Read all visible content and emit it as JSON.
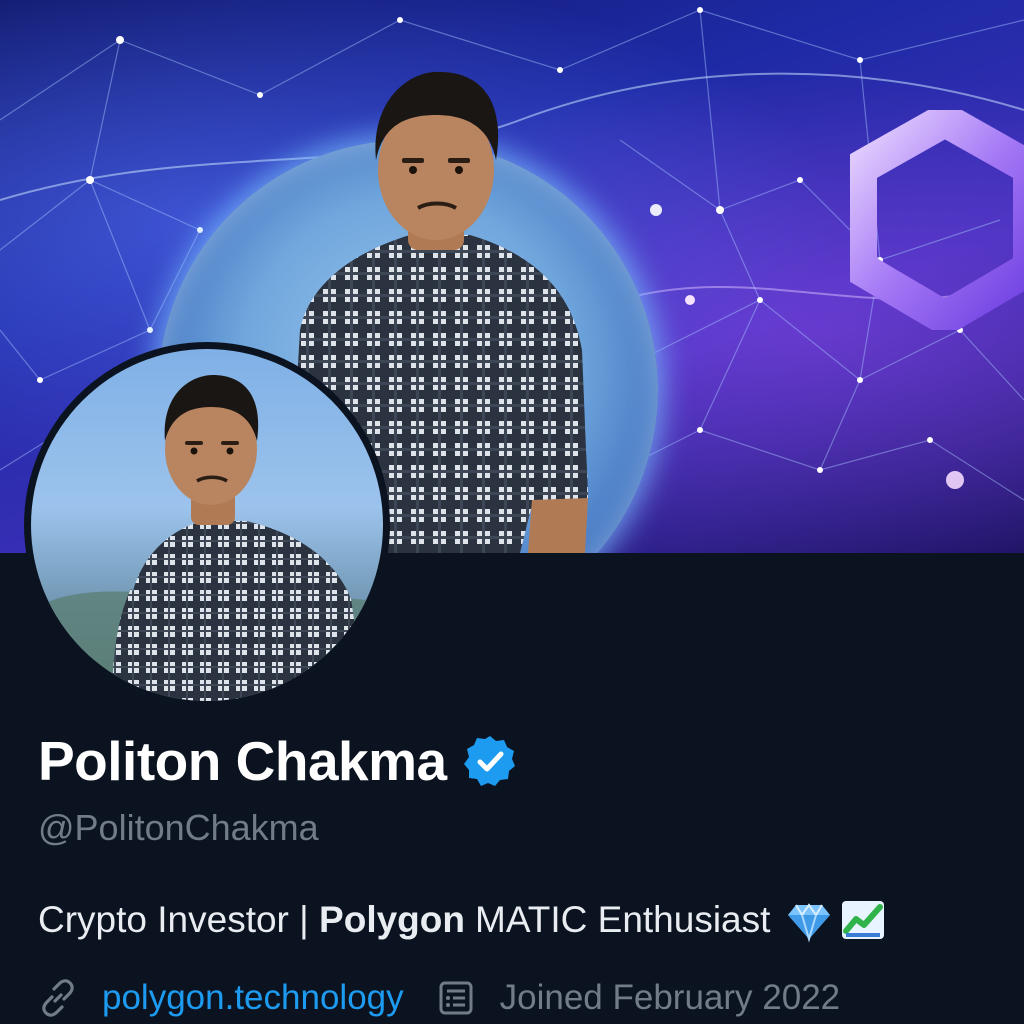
{
  "profile": {
    "display_name": "Politon Chakma",
    "verified": true,
    "handle": "@PolitonChakma",
    "bio": {
      "part1": "Crypto Investor | ",
      "bold": "Polygon",
      "part2": "MATIC Enthusiast",
      "emojis": [
        "gem-stone-emoji",
        "chart-increasing-emoji"
      ]
    },
    "website": "polygon.technology",
    "joined": "Joined February 2022"
  },
  "colors": {
    "background": "#0b1320",
    "verified_badge": "#1d9bf0",
    "link": "#1d9bf0",
    "secondary_text": "#717c88",
    "primary_text": "#ffffff",
    "banner_accent": "#8b5cf6"
  },
  "icons": {
    "verified": "verified-badge-icon",
    "website": "link-icon",
    "joined": "calendar-icon"
  }
}
